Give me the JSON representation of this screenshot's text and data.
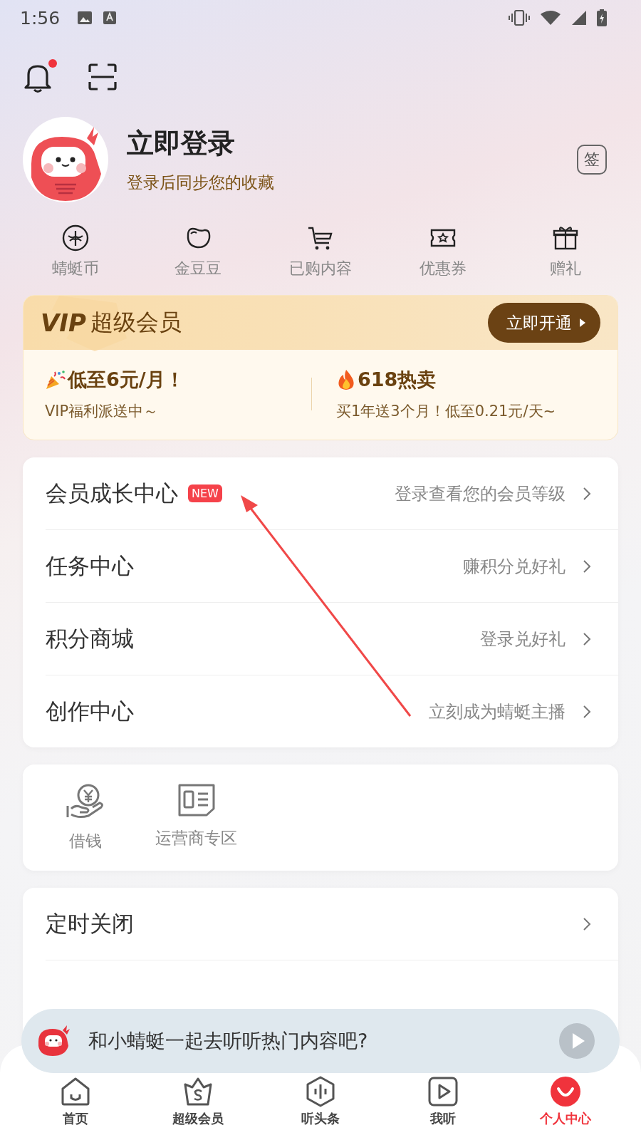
{
  "status_bar": {
    "time": "1:56"
  },
  "header": {
    "has_notification": true
  },
  "profile": {
    "title": "立即登录",
    "subtitle": "登录后同步您的收藏",
    "sign_button": "签"
  },
  "quick_actions": [
    {
      "label": "蜻蜓币"
    },
    {
      "label": "金豆豆"
    },
    {
      "label": "已购内容"
    },
    {
      "label": "优惠券"
    },
    {
      "label": "赠礼"
    }
  ],
  "vip": {
    "brand": "VIP",
    "title": "超级会员",
    "button": "立即开通",
    "promos": [
      {
        "kind": "party",
        "title": "低至6元/月！",
        "subtitle": "VIP福利派送中～"
      },
      {
        "kind": "fire",
        "title": "618热卖",
        "subtitle": "买1年送3个月！低至0.21元/天~"
      }
    ]
  },
  "menu": [
    {
      "label": "会员成长中心",
      "badge": "NEW",
      "hint": "登录查看您的会员等级"
    },
    {
      "label": "任务中心",
      "hint": "赚积分兑好礼"
    },
    {
      "label": "积分商城",
      "hint": "登录兑好礼"
    },
    {
      "label": "创作中心",
      "hint": "立刻成为蜻蜓主播"
    }
  ],
  "services": [
    {
      "label": "借钱"
    },
    {
      "label": "运营商专区"
    }
  ],
  "settings": [
    {
      "label": "定时关闭"
    }
  ],
  "mini_player": {
    "text": "和小蜻蜓一起去听听热门内容吧?"
  },
  "bottom_nav": [
    {
      "label": "首页",
      "selected": false
    },
    {
      "label": "超级会员",
      "selected": false
    },
    {
      "label": "听头条",
      "selected": false
    },
    {
      "label": "我听",
      "selected": false
    },
    {
      "label": "个人中心",
      "selected": true
    }
  ]
}
